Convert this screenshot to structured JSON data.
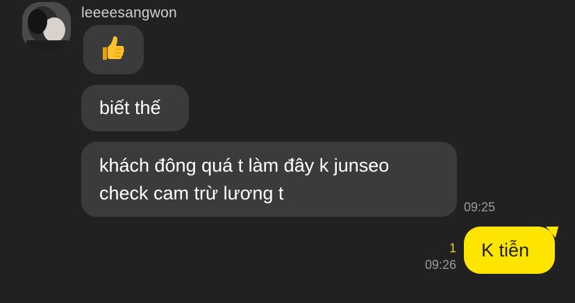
{
  "chat": {
    "sender": "leeeesangwon",
    "messages": [
      {
        "text": "👍"
      },
      {
        "text": "biết thế"
      },
      {
        "line1": "khách đông quá t làm đây k junseo",
        "line2": "check cam trừ lương t",
        "time": "09:25"
      }
    ],
    "outgoing": {
      "text": "K tiễn",
      "unread_count": "1",
      "time": "09:26"
    }
  },
  "colors": {
    "background": "#212121",
    "incoming_bubble": "#3b3b3b",
    "outgoing_bubble": "#fee500",
    "unread": "#f5d20a"
  },
  "icons": {
    "thumbs_up": "thumbs-up-emoji"
  }
}
